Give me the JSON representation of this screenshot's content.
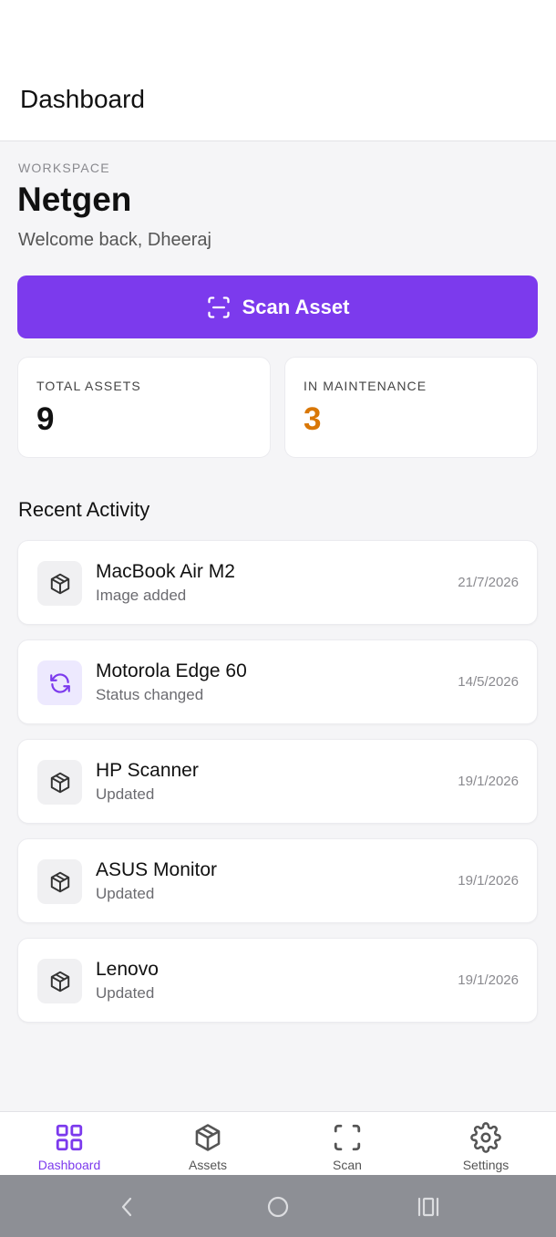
{
  "header": {
    "title": "Dashboard"
  },
  "workspace": {
    "label": "WORKSPACE",
    "name": "Netgen",
    "welcome": "Welcome back, Dheeraj"
  },
  "scan_button": {
    "label": "Scan Asset",
    "icon": "scan-icon"
  },
  "stats": {
    "total_label": "TOTAL ASSETS",
    "total_value": "9",
    "maintenance_label": "IN MAINTENANCE",
    "maintenance_value": "3"
  },
  "recent": {
    "title": "Recent Activity",
    "items": [
      {
        "name": "MacBook Air M2",
        "action": "Image added",
        "date": "21/7/2026",
        "icon": "box-icon"
      },
      {
        "name": "Motorola Edge 60",
        "action": "Status changed",
        "date": "14/5/2026",
        "icon": "refresh-icon"
      },
      {
        "name": "HP Scanner",
        "action": "Updated",
        "date": "19/1/2026",
        "icon": "box-icon"
      },
      {
        "name": "ASUS Monitor",
        "action": "Updated",
        "date": "19/1/2026",
        "icon": "box-icon"
      },
      {
        "name": "Lenovo",
        "action": "Updated",
        "date": "19/1/2026",
        "icon": "box-icon"
      }
    ]
  },
  "nav": {
    "items": [
      {
        "label": "Dashboard",
        "icon": "grid-icon",
        "active": true
      },
      {
        "label": "Assets",
        "icon": "box-icon",
        "active": false
      },
      {
        "label": "Scan",
        "icon": "scan-frame-icon",
        "active": false
      },
      {
        "label": "Settings",
        "icon": "gear-icon",
        "active": false
      }
    ]
  },
  "colors": {
    "accent": "#7c3aed",
    "maintenance": "#d97706",
    "system_bar": "#8d8f95"
  }
}
